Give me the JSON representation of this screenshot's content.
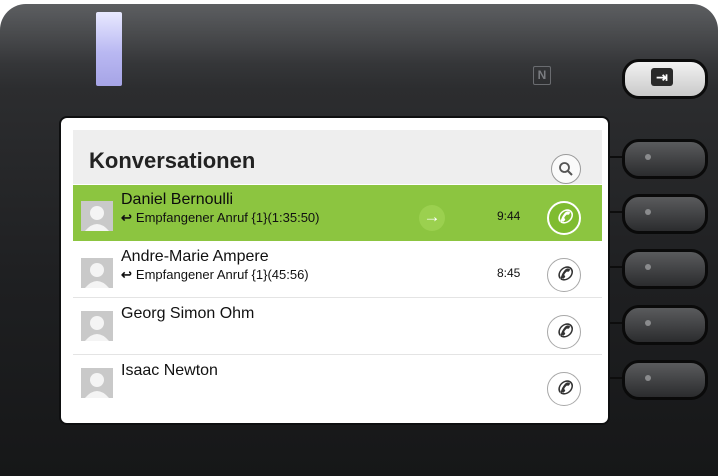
{
  "device": {
    "led_color": "#b6b4f0",
    "nfc_icon": "nfc-icon"
  },
  "header": {
    "title": "Konversationen",
    "search_icon": "search-icon"
  },
  "conversations": [
    {
      "name": "Daniel Bernoulli",
      "sub_icon": "incoming-call-icon",
      "sub_glyph": "↩",
      "detail": "Empfangener Anruf {1}(1:35:50)",
      "time": "9:44",
      "selected": true
    },
    {
      "name": "Andre-Marie Ampere",
      "sub_icon": "incoming-call-icon",
      "sub_glyph": "↩",
      "detail": "Empfangener Anruf {1}(45:56)",
      "time": "8:45",
      "selected": false
    },
    {
      "name": "Georg Simon Ohm",
      "detail": "",
      "time": "",
      "selected": false
    },
    {
      "name": "Isaac Newton",
      "detail": "",
      "time": "",
      "selected": false
    }
  ],
  "colors": {
    "selected_row": "#8cc540",
    "header_bg": "#eeeeee"
  },
  "hardware": {
    "top_button_icon": "exit-icon",
    "top_button_glyph": "⇥"
  }
}
